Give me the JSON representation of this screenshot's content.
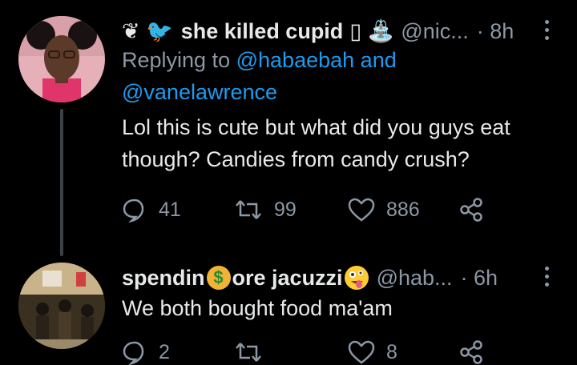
{
  "tweets": [
    {
      "name": "she killed cupid",
      "name_prefix": "❦ 🐦",
      "name_suffix": "▯ ⛲",
      "handle": "@nic...",
      "time": "· 8h",
      "replying_label": "Replying to",
      "mentions": [
        "@habaebah",
        "@vanelawrence"
      ],
      "mention_joiner": "and",
      "text_line1": "Lol this is cute but what did you guys eat",
      "text_line2": "though? Candies from candy crush?",
      "replies": "41",
      "retweets": "99",
      "likes": "886"
    },
    {
      "name_part1": "spendin",
      "name_part2": "ore jacuzzi",
      "emoji_bag": "$",
      "handle": "@hab...",
      "time": "· 6h",
      "text": "We both bought food ma'am",
      "replies": "2",
      "likes": "8"
    }
  ],
  "colors": {
    "background": "#000000",
    "text": "#e7e9ea",
    "muted": "#8b98a5",
    "link": "#1d9bf0",
    "thread_line": "#3e4144"
  },
  "icons": [
    "more-icon",
    "reply-icon",
    "retweet-icon",
    "like-icon",
    "share-icon"
  ]
}
